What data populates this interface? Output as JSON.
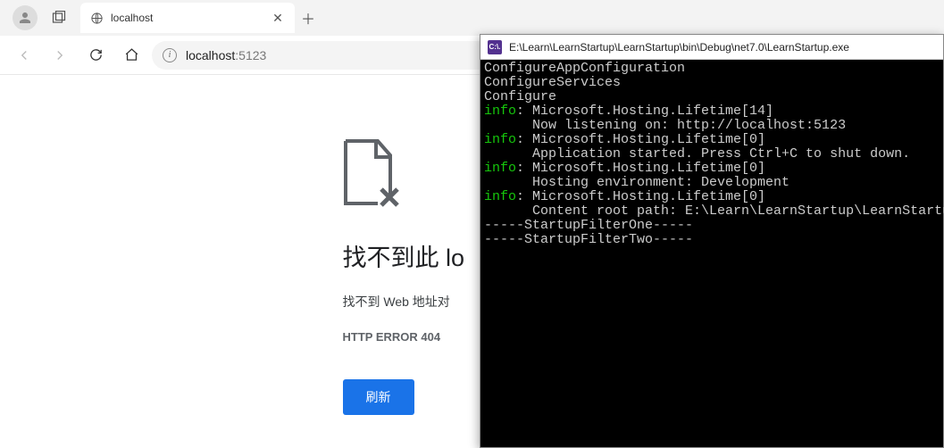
{
  "browser": {
    "tab_title": "localhost",
    "url_host": "localhost",
    "url_port": ":5123"
  },
  "page": {
    "heading": "找不到此 lo",
    "subtitle": "找不到 Web 地址对",
    "error_code": "HTTP ERROR 404",
    "reload_label": "刷新"
  },
  "console": {
    "title_path": "E:\\Learn\\LearnStartup\\LearnStartup\\bin\\Debug\\net7.0\\LearnStartup.exe",
    "icon_label": "C:\\.",
    "lines": {
      "l1": "ConfigureAppConfiguration",
      "l2": "ConfigureServices",
      "l3": "Configure",
      "l4a": "info",
      "l4b": ": Microsoft.Hosting.Lifetime[14]",
      "l5": "      Now listening on: http://localhost:5123",
      "l6a": "info",
      "l6b": ": Microsoft.Hosting.Lifetime[0]",
      "l7": "      Application started. Press Ctrl+C to shut down.",
      "l8a": "info",
      "l8b": ": Microsoft.Hosting.Lifetime[0]",
      "l9": "      Hosting environment: Development",
      "l10a": "info",
      "l10b": ": Microsoft.Hosting.Lifetime[0]",
      "l11": "      Content root path: E:\\Learn\\LearnStartup\\LearnStartup",
      "l12": "-----StartupFilterOne-----",
      "l13": "-----StartupFilterTwo-----"
    }
  }
}
